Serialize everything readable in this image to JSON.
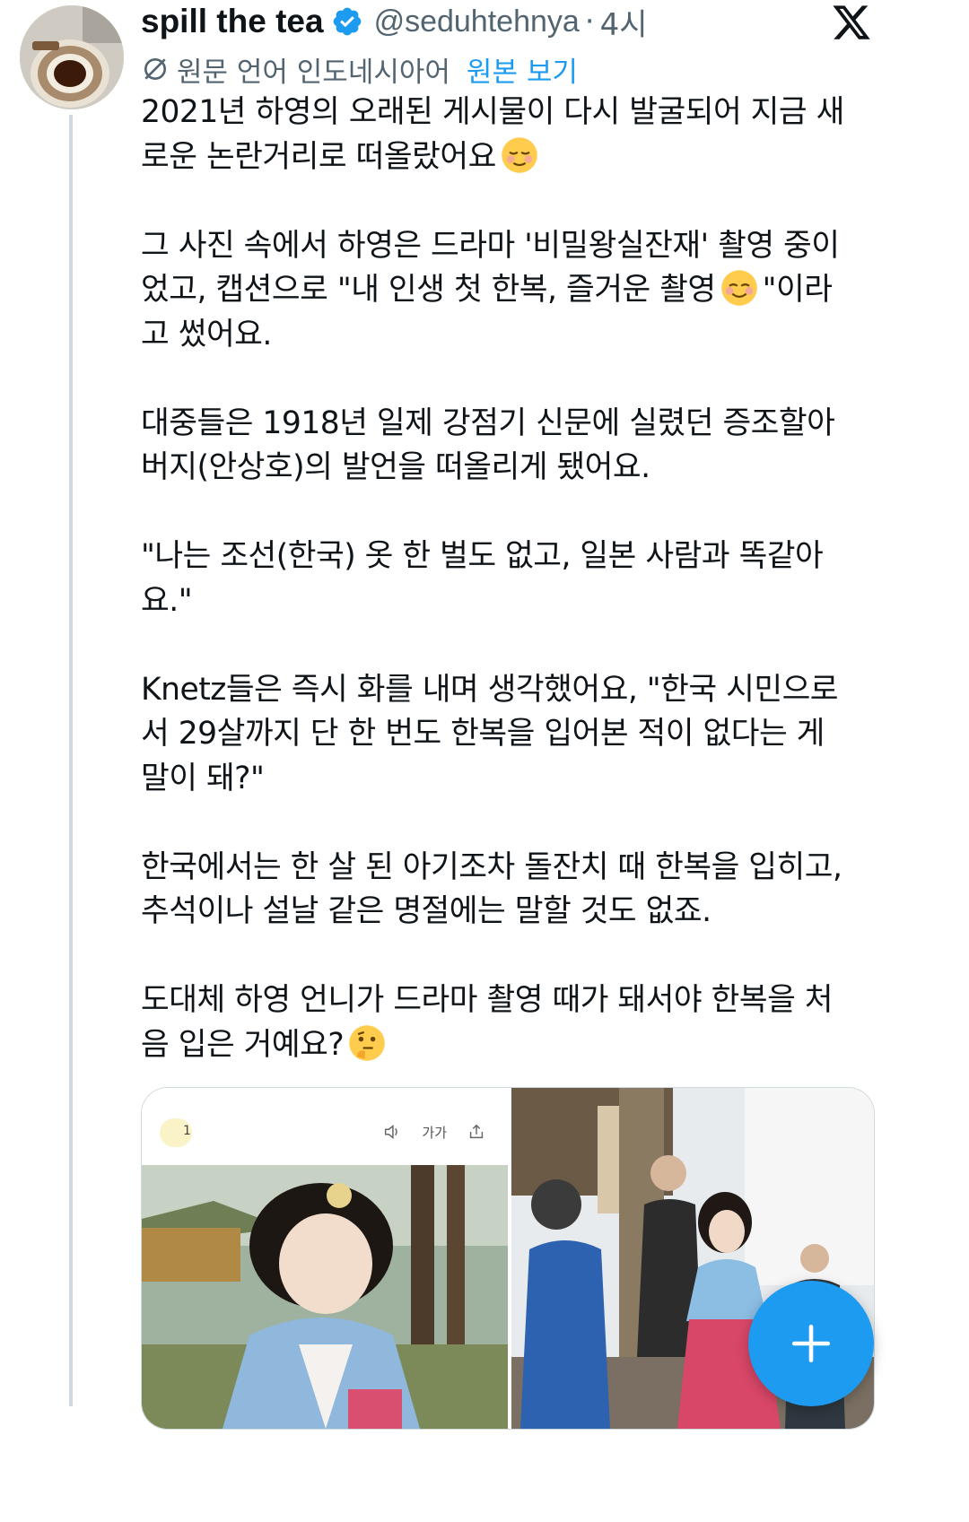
{
  "author": {
    "name": "spill the tea",
    "handle": "@seduhtehnya",
    "separator": "·",
    "time": "4시",
    "avatar_icon": "tea-cup-avatar",
    "verified_icon": "verified-badge-icon",
    "platform_icon": "x-logo-icon"
  },
  "translation": {
    "label": "원문 언어 인도네시아어",
    "view_original": "원본 보기",
    "icon": "translate-icon"
  },
  "tweet": {
    "paragraphs": [
      {
        "before": "2021년 하영의 오래된 게시물이 다시 발굴되어 지금 새\n로운 논란거리로 떠올랐어요",
        "emoji": "relieved-face-emoji",
        "after": ""
      },
      {
        "before": "그 사진 속에서 하영은 드라마 '비밀왕실잔재' 촬영 중이\n었고, 캡션으로 \"내 인생 첫 한복, 즐거운 촬영",
        "emoji": "smiling-face-emoji",
        "after": "\"이라\n고 썼어요."
      },
      {
        "before": "대중들은 1918년 일제 강점기 신문에 실렸던 증조할아\n버지(안상호)의 발언을 떠올리게 됐어요.",
        "emoji": "",
        "after": ""
      },
      {
        "before": "\"나는 조선(한국) 옷 한 벌도 없고, 일본 사람과 똑같아\n요.\"",
        "emoji": "",
        "after": ""
      },
      {
        "before": "Knetz들은 즉시 화를 내며 생각했어요, \"한국 시민으로\n서 29살까지 단 한 번도 한복을 입어본 적이 없다는 게\n말이 돼?\"",
        "emoji": "",
        "after": ""
      },
      {
        "before": "한국에서는 한 살 된 아기조차 돌잔치 때 한복을 입히고,\n추석이나 설날 같은 명절에는 말할 것도 없죠.",
        "emoji": "",
        "after": ""
      },
      {
        "before": "도대체 하영 언니가 드라마 촬영 때가 돼서야 한복을 처\n음 입은 거예요?",
        "emoji": "thinking-face-emoji",
        "after": ""
      }
    ]
  },
  "media": {
    "left": {
      "reaction_count": "1",
      "font_size_label": "가가",
      "icons": [
        "speaker-icon",
        "share-icon"
      ]
    },
    "right": {}
  },
  "fab": {
    "icon": "plus-icon"
  },
  "colors": {
    "accent": "#1d9bf0",
    "text": "#0f1419",
    "secondary": "#536471",
    "thread_line": "#cfd9de"
  }
}
